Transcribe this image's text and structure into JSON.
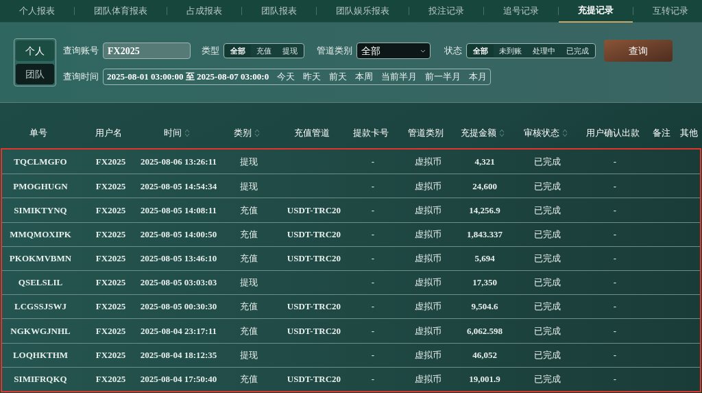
{
  "tabs": [
    {
      "label": "个人报表",
      "selected": false
    },
    {
      "label": "团队体育报表",
      "selected": false
    },
    {
      "label": "占成报表",
      "selected": false
    },
    {
      "label": "团队报表",
      "selected": false
    },
    {
      "label": "团队娱乐报表",
      "selected": false
    },
    {
      "label": "投注记录",
      "selected": false
    },
    {
      "label": "追号记录",
      "selected": false
    },
    {
      "label": "充提记录",
      "selected": true
    },
    {
      "label": "互转记录",
      "selected": false
    }
  ],
  "scope": [
    {
      "label": "个人",
      "selected": true
    },
    {
      "label": "团队",
      "selected": false
    }
  ],
  "filters": {
    "account_label": "查询账号",
    "account_value": "FX2025",
    "type_label": "类型",
    "type_options": [
      {
        "label": "全部",
        "selected": true
      },
      {
        "label": "充值",
        "selected": false
      },
      {
        "label": "提现",
        "selected": false
      }
    ],
    "pipe_label": "管道类别",
    "pipe_value": "全部",
    "status_label": "状态",
    "status_options": [
      {
        "label": "全部",
        "selected": true
      },
      {
        "label": "未到账",
        "selected": false
      },
      {
        "label": "处理中",
        "selected": false
      },
      {
        "label": "已完成",
        "selected": false
      }
    ],
    "query_button": "查询",
    "time_label": "查询时间",
    "time_value": "2025-08-01 03:00:00 至 2025-08-07 03:00:0",
    "quick_ranges": [
      "今天",
      "昨天",
      "前天",
      "本周",
      "当前半月",
      "前一半月",
      "本月"
    ]
  },
  "table": {
    "columns": [
      {
        "label": "单号",
        "sortable": false
      },
      {
        "label": "用户名",
        "sortable": false
      },
      {
        "label": "时间",
        "sortable": true
      },
      {
        "label": "类别",
        "sortable": true
      },
      {
        "label": "充值管道",
        "sortable": false
      },
      {
        "label": "提款卡号",
        "sortable": false
      },
      {
        "label": "管道类别",
        "sortable": false
      },
      {
        "label": "充提金额",
        "sortable": true
      },
      {
        "label": "审核状态",
        "sortable": true
      },
      {
        "label": "用户确认出款",
        "sortable": false
      },
      {
        "label": "备注",
        "sortable": false
      },
      {
        "label": "其他",
        "sortable": false
      }
    ],
    "rows": [
      [
        "TQCLMGFO",
        "FX2025",
        "2025-08-06 13:26:11",
        "提现",
        "",
        "-",
        "虚拟币",
        "4,321",
        "已完成",
        "-"
      ],
      [
        "PMOGHUGN",
        "FX2025",
        "2025-08-05 14:54:34",
        "提现",
        "",
        "-",
        "虚拟币",
        "24,600",
        "已完成",
        "-"
      ],
      [
        "SIMIKTYNQ",
        "FX2025",
        "2025-08-05 14:08:11",
        "充值",
        "USDT-TRC20",
        "-",
        "虚拟币",
        "14,256.9",
        "已完成",
        "-"
      ],
      [
        "MMQMOXIPK",
        "FX2025",
        "2025-08-05 14:00:50",
        "充值",
        "USDT-TRC20",
        "-",
        "虚拟币",
        "1,843.337",
        "已完成",
        "-"
      ],
      [
        "PKOKMVBMN",
        "FX2025",
        "2025-08-05 13:46:10",
        "充值",
        "USDT-TRC20",
        "-",
        "虚拟币",
        "5,694",
        "已完成",
        "-"
      ],
      [
        "QSELSLIL",
        "FX2025",
        "2025-08-05 03:03:03",
        "提现",
        "",
        "-",
        "虚拟币",
        "17,350",
        "已完成",
        "-"
      ],
      [
        "LCGSSJSWJ",
        "FX2025",
        "2025-08-05 00:30:30",
        "充值",
        "USDT-TRC20",
        "-",
        "虚拟币",
        "9,504.6",
        "已完成",
        "-"
      ],
      [
        "NGKWGJNHL",
        "FX2025",
        "2025-08-04 23:17:11",
        "充值",
        "USDT-TRC20",
        "-",
        "虚拟币",
        "6,062.598",
        "已完成",
        "-"
      ],
      [
        "LOQHKTHM",
        "FX2025",
        "2025-08-04 18:12:35",
        "提现",
        "",
        "-",
        "虚拟币",
        "46,052",
        "已完成",
        "-"
      ],
      [
        "SIMIFRQKQ",
        "FX2025",
        "2025-08-04 17:50:40",
        "充值",
        "USDT-TRC20",
        "-",
        "虚拟币",
        "19,001.9",
        "已完成",
        "-"
      ]
    ]
  }
}
